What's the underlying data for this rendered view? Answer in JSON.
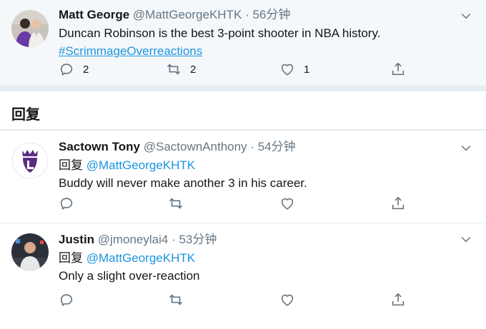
{
  "main_tweet": {
    "name": "Matt George",
    "handle": "@MattGeorgeKHTK",
    "dot": "·",
    "time": "56分钟",
    "text": "Duncan Robinson is the best 3-point shooter in NBA history.",
    "hashtag": "#ScrimmageOverreactions",
    "reply_count": "2",
    "retweet_count": "2",
    "like_count": "1"
  },
  "replies_section": {
    "title": "回复"
  },
  "replies": [
    {
      "name": "Sactown Tony",
      "handle": "@SactownAnthony",
      "dot": "·",
      "time": "54分钟",
      "replying_label": "回复",
      "replying_to": "@MattGeorgeKHTK",
      "text": "Buddy will never make another 3 in his career."
    },
    {
      "name": "Justin",
      "handle": "@jmoneylai4",
      "dot": "·",
      "time": "53分钟",
      "replying_label": "回复",
      "replying_to": "@MattGeorgeKHTK",
      "text": "Only a slight over-reaction"
    }
  ],
  "colors": {
    "link": "#1b95e0",
    "secondary_text": "#657786",
    "main_bg": "#f5f8fa",
    "divider": "#e6ecf0",
    "kings_purple": "#5a2d81"
  },
  "icons": [
    "chevron-down-icon",
    "reply-icon",
    "retweet-icon",
    "like-icon",
    "share-icon"
  ]
}
